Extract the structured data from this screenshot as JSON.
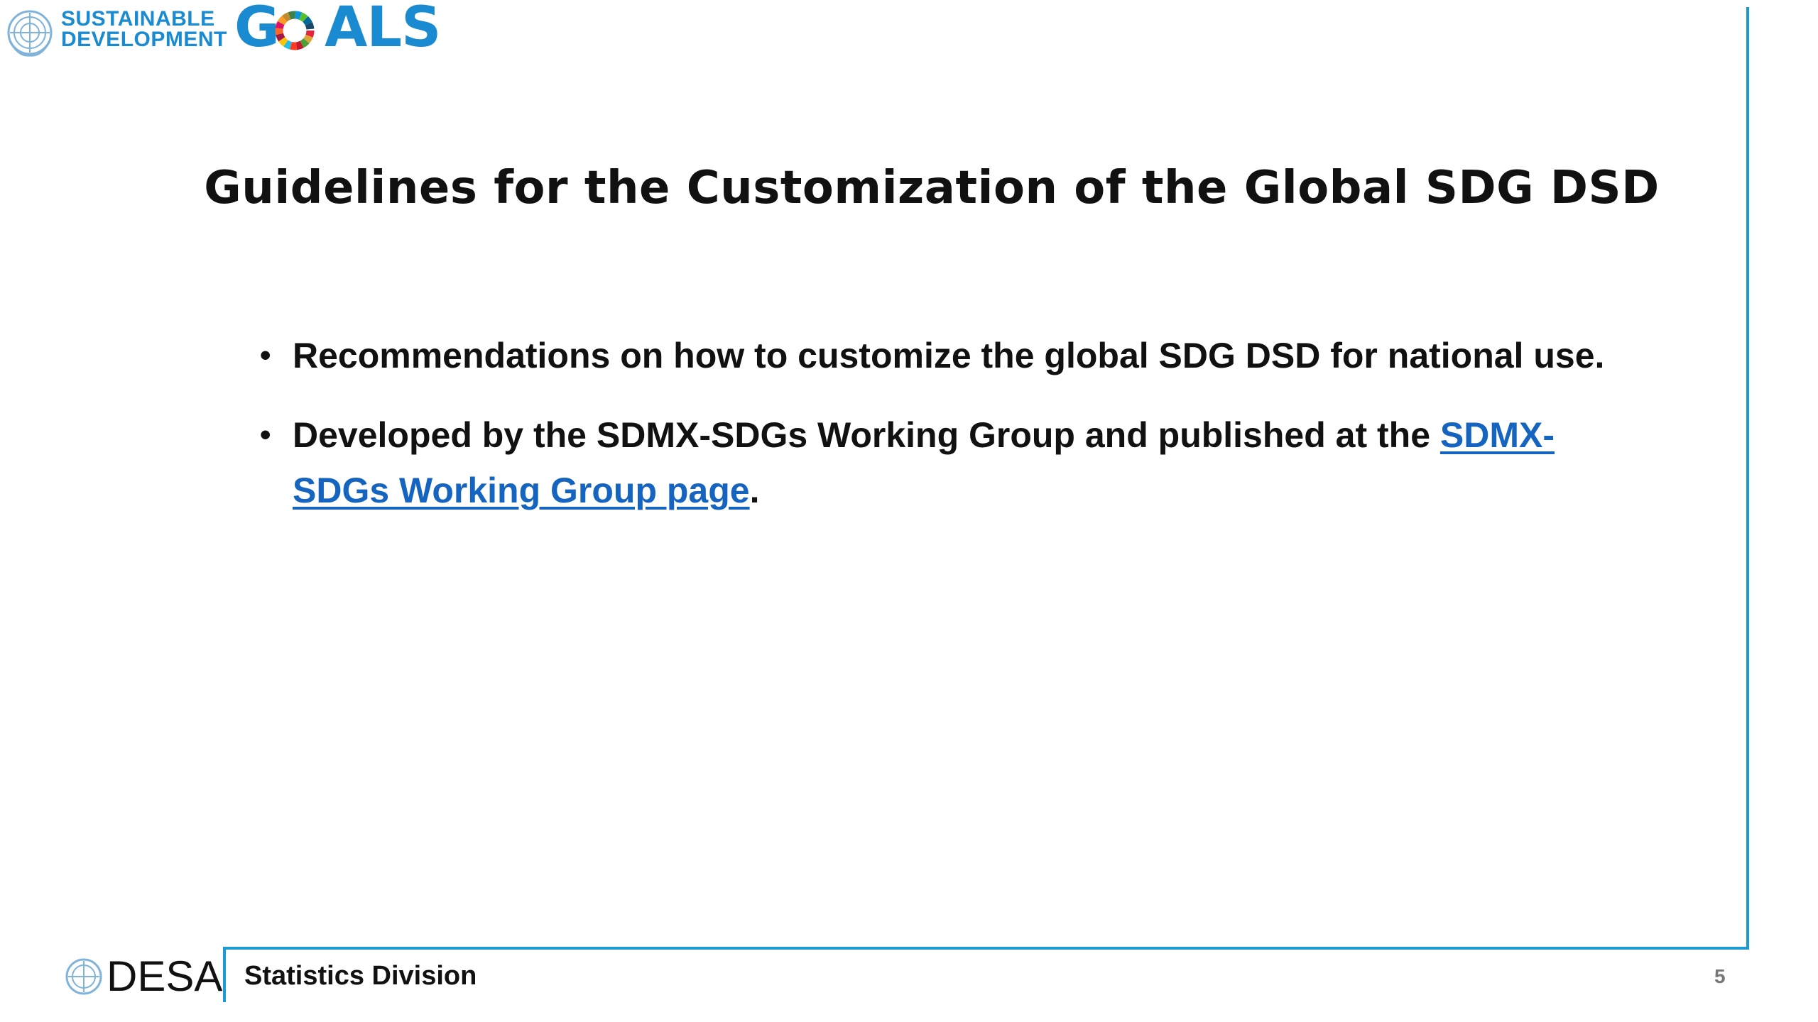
{
  "header": {
    "logo_line1": "SUSTAINABLE",
    "logo_line2": "DEVELOPMENT",
    "logo_goals_g": "G",
    "logo_goals_rest": "ALS",
    "brand_color": "#1a8bd0"
  },
  "slide": {
    "title": "Guidelines for the Customization of the Global SDG DSD",
    "bullets": [
      {
        "text": "Recommendations on how to customize the global SDG DSD for national use."
      },
      {
        "text_before": "Developed by the SDMX-SDGs Working Group and published at the ",
        "link_text": "SDMX-SDGs Working Group page",
        "text_after": "."
      }
    ],
    "link_color": "#1565c0",
    "frame_color": "#1d99d4"
  },
  "footer": {
    "org": "DESA",
    "division": "Statistics Division",
    "page_number": "5"
  }
}
